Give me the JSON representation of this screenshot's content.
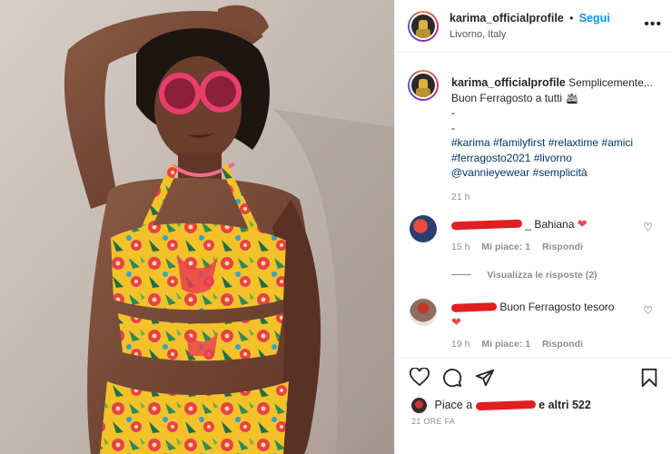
{
  "post": {
    "username": "karima_officialprofile",
    "follow_label": "Segui",
    "follow_dot": "•",
    "location": "Livorno, Italy",
    "more_icon": "more-options-icon"
  },
  "caption": {
    "username": "karima_officialprofile",
    "line1": "Semplicemente...",
    "line2": "Buon Ferragosto a tutti",
    "dash1": "-",
    "dash2": "-",
    "tags_line1": [
      "#karima",
      "#familyfirst",
      "#relaxtime",
      "#amici"
    ],
    "tags_line2": [
      "#ferragosto2021",
      "#livorno"
    ],
    "tags_line3": [
      "@vannieyewear",
      "#semplicità"
    ],
    "time": "21 h"
  },
  "comments": [
    {
      "text": "_ Bahiana",
      "emoji": "❤",
      "time": "15 h",
      "likes": "Mi piace: 1",
      "reply": "Rispondi",
      "view_replies": "Visualizza le risposte (2)"
    },
    {
      "text": "Buon Ferragosto tesoro",
      "emoji": "❤",
      "time": "19 h",
      "likes": "Mi piace: 1",
      "reply": "Rispondi"
    }
  ],
  "actions": {
    "liked_by_prefix": "Piace a",
    "liked_by_suffix": "e altri 522",
    "time_ago": "21 ORE FA"
  },
  "colors": {
    "accent": "#0095f6",
    "hashtag": "#00376b",
    "secondary_text": "#8e8e8e",
    "like_red": "#ed4956",
    "redaction": "#e02020"
  }
}
